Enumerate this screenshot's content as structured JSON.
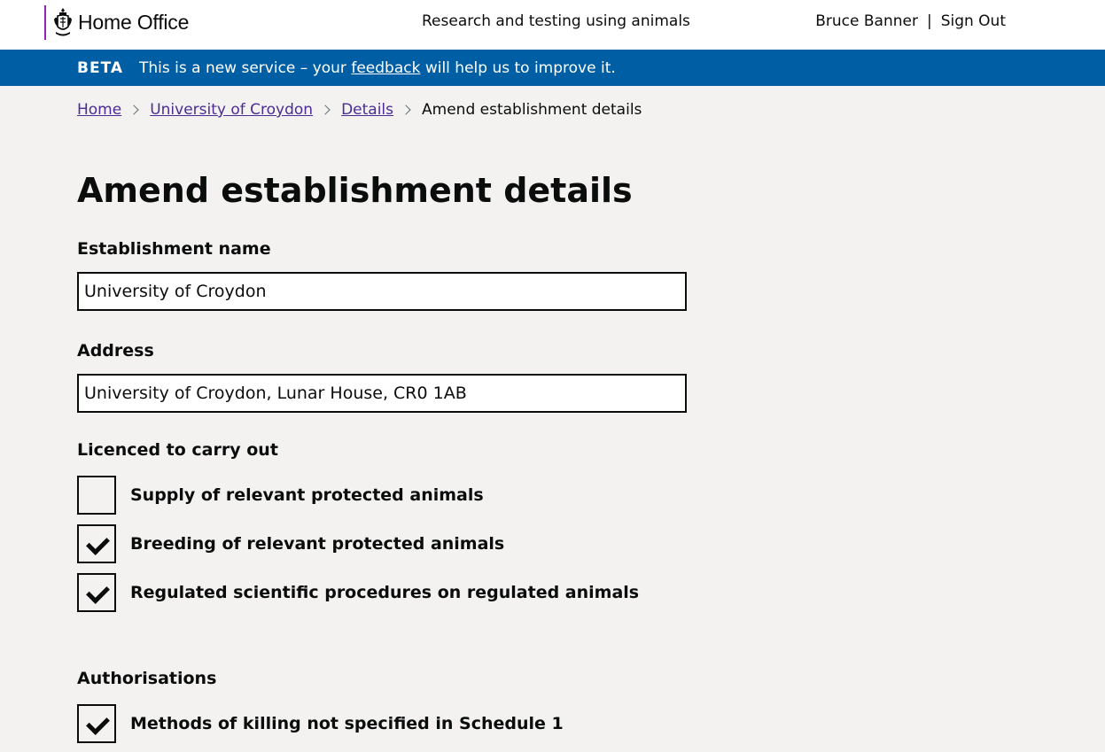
{
  "header": {
    "logo_text": "Home Office",
    "service_name": "Research and testing using animals",
    "user_name": "Bruce Banner",
    "separator": "|",
    "sign_out": "Sign Out"
  },
  "beta": {
    "tag": "BETA",
    "message_before": "This is a new service – your ",
    "feedback_link": "feedback",
    "message_after": " will help us to improve it."
  },
  "breadcrumbs": {
    "items": [
      "Home",
      "University of Croydon",
      "Details"
    ],
    "current": "Amend establishment details"
  },
  "page_title": "Amend establishment details",
  "form": {
    "name_label": "Establishment name",
    "name_value": "University of Croydon",
    "address_label": "Address",
    "address_value": "University of Croydon, Lunar House, CR0 1AB",
    "licences_label": "Licenced to carry out",
    "licences": [
      {
        "label": "Supply of relevant protected animals",
        "checked": false
      },
      {
        "label": "Breeding of relevant protected animals",
        "checked": true
      },
      {
        "label": "Regulated scientific procedures on regulated animals",
        "checked": true
      }
    ],
    "authorisations_label": "Authorisations",
    "authorisations": [
      {
        "label": "Methods of killing not specified in Schedule 1",
        "checked": true
      }
    ]
  },
  "colors": {
    "beta_bar": "#005ea5",
    "link": "#4c2c92",
    "logo_rule": "#9325b2",
    "background": "#f3f2f1"
  }
}
